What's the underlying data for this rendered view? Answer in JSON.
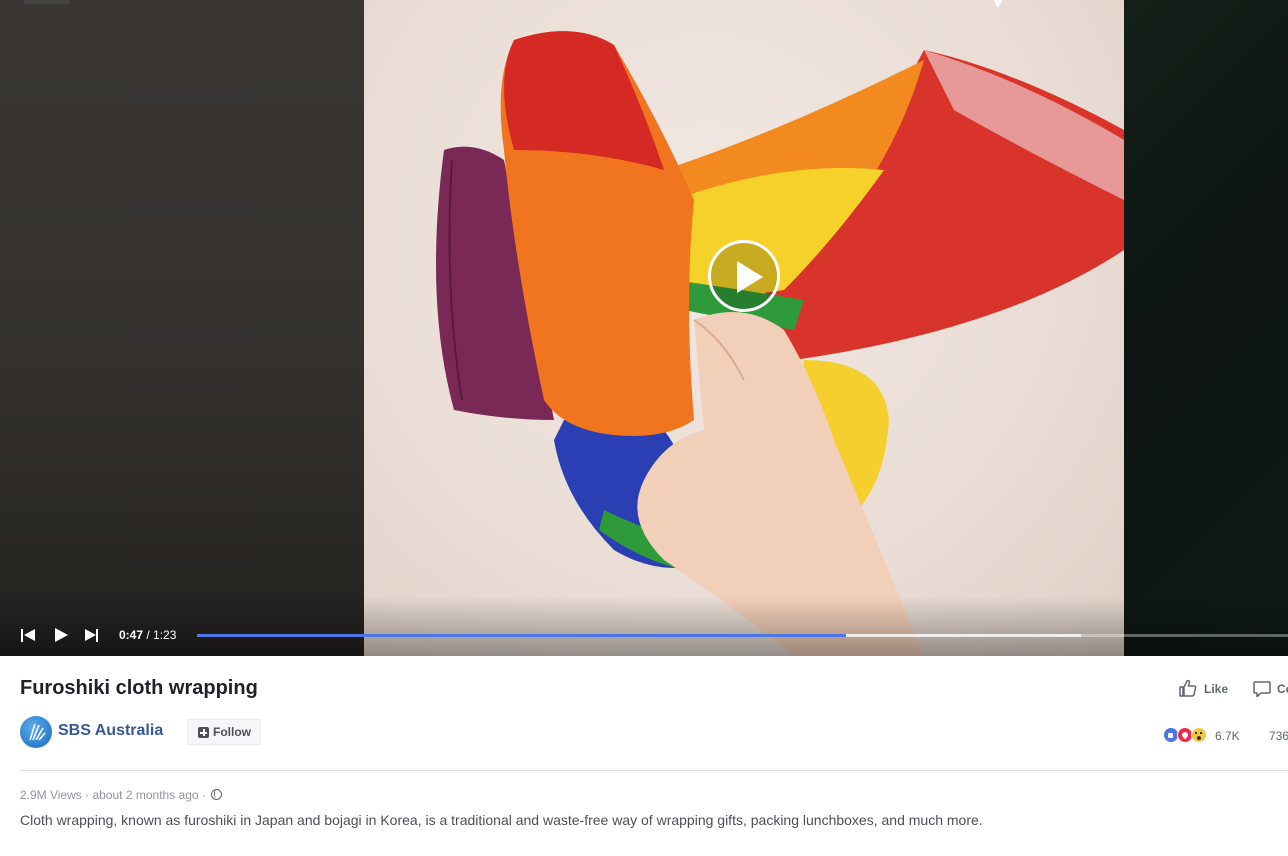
{
  "video": {
    "current_time": "0:47",
    "separator": " / ",
    "duration": "1:23",
    "progress_played": 0.595,
    "progress_buffered": 0.81,
    "progress_color": "#4a76e8"
  },
  "post": {
    "title": "Furoshiki cloth wrapping",
    "page_name": "SBS Australia",
    "follow_label": "Follow",
    "like_label": "Like",
    "comment_label": "Comment",
    "reaction_count": "6.7K",
    "comment_count": "736",
    "views": "2.9M Views",
    "posted": "about 2 months ago",
    "meta_sep": " · ",
    "description": "Cloth wrapping, known as furoshiki in Japan and bojagi in Korea, is a traditional and waste-free way of wrapping gifts, packing lunchboxes, and much more."
  },
  "icons": {
    "prev": "skip-previous-icon",
    "play": "play-icon",
    "next": "skip-next-icon",
    "like": "thumbs-up-icon",
    "comment": "comment-bubble-icon",
    "privacy": "globe-icon",
    "reactions": [
      "like-reaction-icon",
      "love-reaction-icon",
      "wow-reaction-icon"
    ]
  },
  "colors": {
    "link": "#365899",
    "accent": "#4a76e8"
  }
}
